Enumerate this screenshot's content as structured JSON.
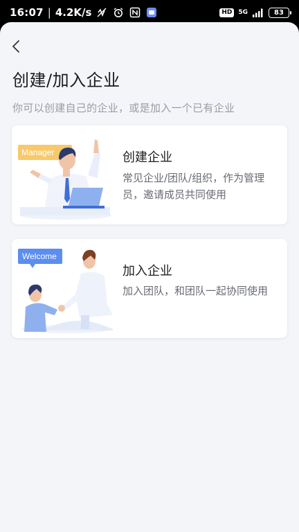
{
  "status_bar": {
    "time": "16:07",
    "separator": "|",
    "net_speed": "4.2K/s",
    "hd_label": "HD",
    "network_label": "5G",
    "battery": "83"
  },
  "page": {
    "title": "创建/加入企业",
    "subtitle": "你可以创建自己的企业，或是加入一个已有企业"
  },
  "cards": [
    {
      "title": "创建企业",
      "description": "常见企业/团队/组织，作为管理员，邀请成员共同使用",
      "illustration_tag": "Manager"
    },
    {
      "title": "加入企业",
      "description": "加入团队，和团队一起协同使用",
      "illustration_tag": "Welcome"
    }
  ],
  "colors": {
    "manager_tag": "#f7c96a",
    "welcome_tag": "#5b8ef0",
    "accent_blue": "#3f6fd8",
    "background": "#f4f5f9"
  }
}
